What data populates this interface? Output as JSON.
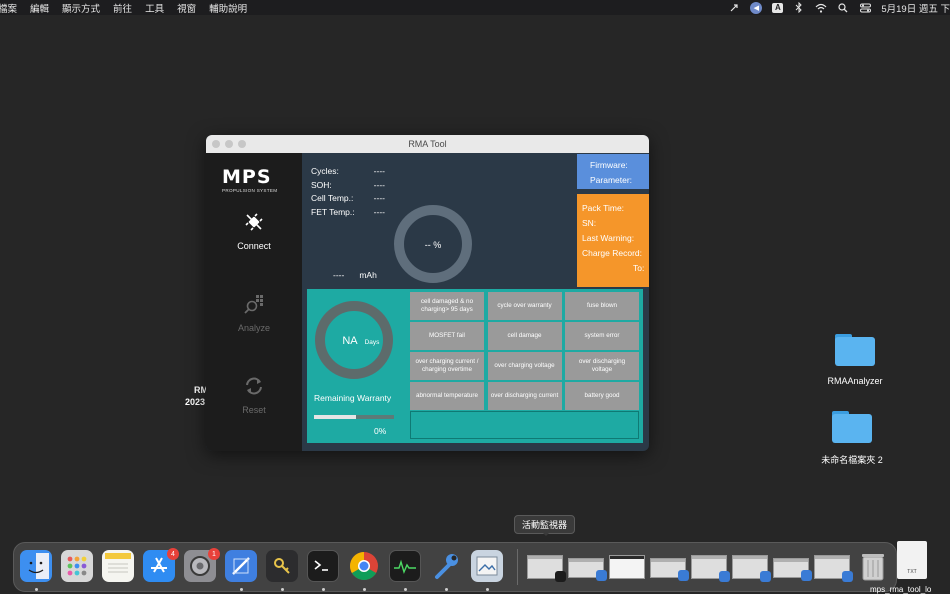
{
  "menubar": {
    "items": [
      "檔案",
      "編輯",
      "顯示方式",
      "前往",
      "工具",
      "視窗",
      "輔助說明"
    ],
    "clock": "5月19日 週五 下"
  },
  "window": {
    "title": "RMA Tool",
    "logo_text": "MPS",
    "logo_sub": "PROPULSION SYSTEM",
    "nav": {
      "connect": "Connect",
      "analyze": "Analyze",
      "reset": "Reset"
    },
    "stats": [
      {
        "label": "Cycles:",
        "value": "----"
      },
      {
        "label": "SOH:",
        "value": "----"
      },
      {
        "label": "Cell Temp.:",
        "value": "----"
      },
      {
        "label": "FET Temp.:",
        "value": "----"
      }
    ],
    "donut_label": "-- %",
    "capacity": {
      "value": "----",
      "unit": "mAh"
    },
    "firmware": {
      "label": "Firmware:",
      "value": "----"
    },
    "parameter": {
      "label": "Parameter:",
      "value": "----"
    },
    "pack_info": [
      {
        "label": "Pack Time:",
        "value": "----"
      },
      {
        "label": "SN:",
        "value": "----"
      },
      {
        "label": "Last Warning:",
        "value": "----"
      },
      {
        "label": "Charge Record:",
        "value": "----"
      },
      {
        "label": "To:",
        "value": "----"
      }
    ],
    "warranty": {
      "value": "NA",
      "unit": "Days",
      "label": "Remaining Warranty",
      "progress_fraction": 0.52,
      "percent_text": "0%"
    },
    "status_cells": [
      "cell damaged & no charging> 95 days",
      "cycle over warranty",
      "fuse blown",
      "MOSFET fail",
      "cell damage",
      "system error",
      "over charging current / charging overtime",
      "over charging voltage",
      "over discharging voltage",
      "abnormal temperature",
      "over discharging current",
      "battery good"
    ]
  },
  "desktop": {
    "left_text_1": "RM",
    "left_text_2": "2023",
    "folder1": "RMAAnalyzer",
    "folder2": "未命名檔案夾 2"
  },
  "dock": {
    "tooltip": "活動監視器",
    "appstore_badge": "4",
    "settings_badge": "1",
    "file_name": "mps_rma_tool_lo",
    "file_type": "TXT"
  },
  "colors": {
    "teal": "#1eaaa3",
    "orange": "#f5962a",
    "blue": "#5a8fdc",
    "panel": "#2b3947",
    "cell": "#9a9a9a"
  }
}
